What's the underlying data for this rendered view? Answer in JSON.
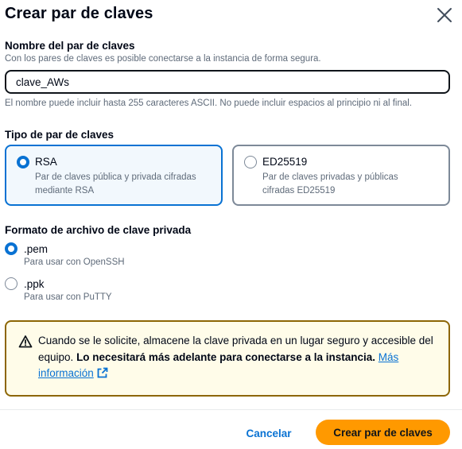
{
  "dialog": {
    "title": "Crear par de claves",
    "close_icon": "close-icon"
  },
  "key_name": {
    "label": "Nombre del par de claves",
    "description": "Con los pares de claves es posible conectarse a la instancia de forma segura.",
    "value": "clave_AWs",
    "constraint": "El nombre puede incluir hasta 255 caracteres ASCII. No puede incluir espacios al principio ni al final."
  },
  "key_type": {
    "label": "Tipo de par de claves",
    "options": [
      {
        "label": "RSA",
        "description_line1": "Par de claves pública y privada cifradas",
        "description_line2": "mediante RSA",
        "selected": true
      },
      {
        "label": "ED25519",
        "description_line1": "Par de claves privadas y públicas",
        "description_line2": "cifradas ED25519",
        "selected": false
      }
    ]
  },
  "file_format": {
    "label": "Formato de archivo de clave privada",
    "options": [
      {
        "label": ".pem",
        "description": "Para usar con OpenSSH",
        "selected": true
      },
      {
        "label": ".ppk",
        "description": "Para usar con PuTTY",
        "selected": false
      }
    ]
  },
  "alert": {
    "icon": "warning-icon",
    "text": "Cuando se le solicite, almacene la clave privada en un lugar seguro y accesible del equipo.",
    "bold_text": "Lo necesitará más adelante para conectarse a la instancia.",
    "link_text": "Más información",
    "link_icon": "external-link-icon"
  },
  "footer": {
    "cancel_label": "Cancelar",
    "create_label": "Crear par de claves"
  },
  "colors": {
    "accent": "#0972d3",
    "primary_button": "#ff9900",
    "warning_border": "#8d6605",
    "warning_background": "#fffce9"
  }
}
